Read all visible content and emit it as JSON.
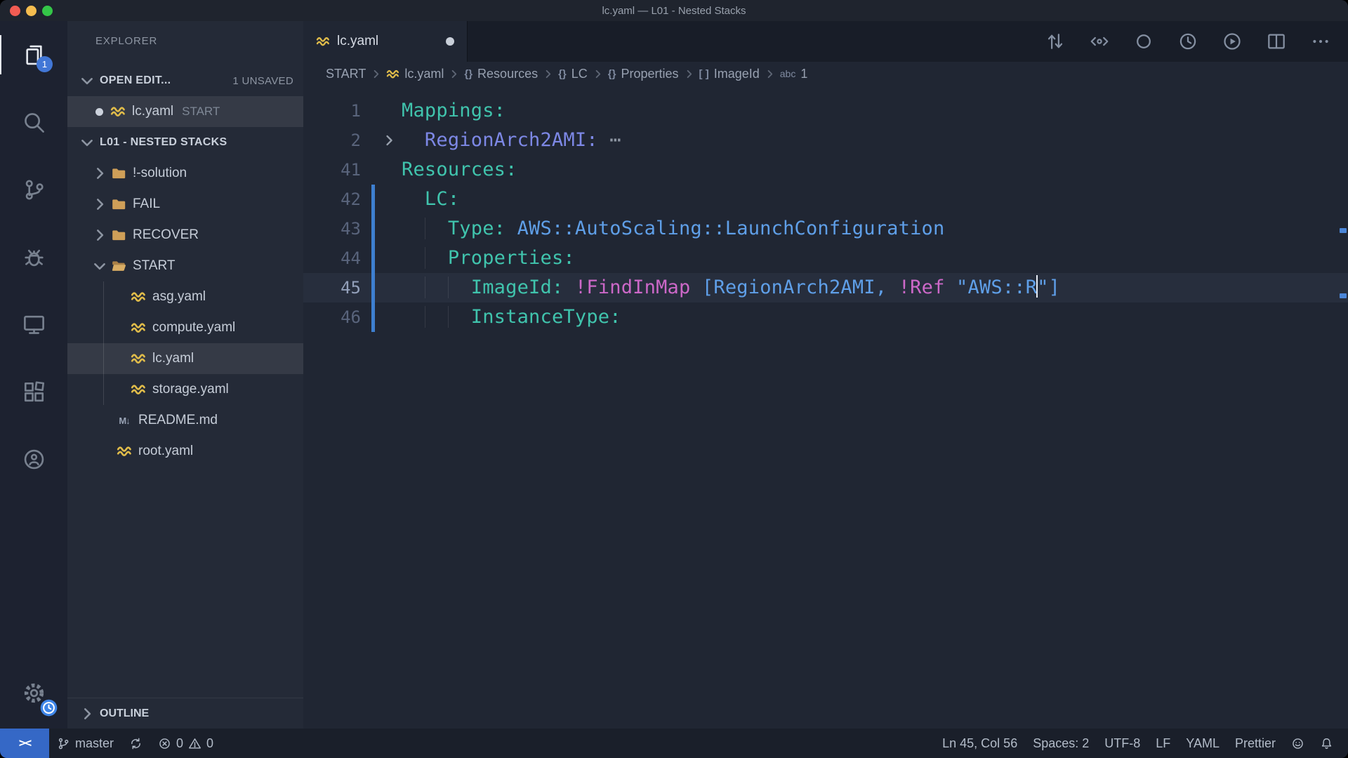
{
  "window": {
    "title": "lc.yaml — L01 - Nested Stacks"
  },
  "activity_bar": {
    "items": [
      {
        "name": "explorer",
        "icon": "files",
        "active": true,
        "badge": "1"
      },
      {
        "name": "search",
        "icon": "search"
      },
      {
        "name": "source-control",
        "icon": "source-control"
      },
      {
        "name": "run-and-debug",
        "icon": "debug"
      },
      {
        "name": "remote-explorer",
        "icon": "remote-explorer"
      },
      {
        "name": "extensions",
        "icon": "extensions"
      },
      {
        "name": "live-share",
        "icon": "live-share"
      }
    ],
    "bottom_items": [
      {
        "name": "manage",
        "icon": "gear",
        "badge_icon": "clock"
      }
    ]
  },
  "sidebar": {
    "title": "EXPLORER",
    "rows": [
      {
        "kind": "section",
        "name": "open-editors-header",
        "label": "OPEN EDIT...",
        "chevron": "down",
        "badge": "1 UNSAVED"
      },
      {
        "kind": "open-editor",
        "icon": "yaml",
        "label": "lc.yaml",
        "decoration": "START",
        "modified": true,
        "selected": true
      },
      {
        "kind": "section",
        "name": "project-section-header",
        "label": "L01 - NESTED STACKS",
        "chevron": "down"
      },
      {
        "kind": "folder",
        "label": "!-solution",
        "chevron": "right"
      },
      {
        "kind": "folder",
        "label": "FAIL",
        "chevron": "right"
      },
      {
        "kind": "folder",
        "label": "RECOVER",
        "chevron": "right"
      },
      {
        "kind": "folder",
        "label": "START",
        "chevron": "down",
        "open": true
      },
      {
        "kind": "file",
        "icon": "yaml",
        "label": "asg.yaml",
        "depth": 2
      },
      {
        "kind": "file",
        "icon": "yaml",
        "label": "compute.yaml",
        "depth": 2
      },
      {
        "kind": "file",
        "icon": "yaml",
        "label": "lc.yaml",
        "depth": 2,
        "selected": true
      },
      {
        "kind": "file",
        "icon": "yaml",
        "label": "storage.yaml",
        "depth": 2
      },
      {
        "kind": "file",
        "icon": "md",
        "label": "README.md",
        "depth": 1
      },
      {
        "kind": "file",
        "icon": "yaml",
        "label": "root.yaml",
        "depth": 1
      }
    ],
    "outline_label": "OUTLINE"
  },
  "editor": {
    "tab": {
      "label": "lc.yaml",
      "icon": "yaml",
      "modified": true
    },
    "actions": [
      "compare-changes",
      "code-lens",
      "circle",
      "file-history",
      "run-code",
      "split-editor",
      "more-actions"
    ],
    "breadcrumbs": [
      {
        "label": "START"
      },
      {
        "icon": "yaml",
        "label": "lc.yaml"
      },
      {
        "icon": "object",
        "label": "Resources"
      },
      {
        "icon": "object",
        "label": "LC"
      },
      {
        "icon": "object",
        "label": "Properties"
      },
      {
        "icon": "array",
        "label": "ImageId"
      },
      {
        "icon": "string",
        "label": "1"
      }
    ],
    "lines": [
      {
        "n": "1",
        "tokens": [
          [
            "key",
            "Mappings:"
          ]
        ]
      },
      {
        "n": "2",
        "fold": true,
        "tokens": [
          [
            "ind",
            "  "
          ],
          [
            "key2",
            "RegionArch2AMI:"
          ],
          [
            "plain",
            " "
          ],
          [
            "fold",
            "⋯"
          ]
        ]
      },
      {
        "n": "41",
        "tokens": [
          [
            "key",
            "Resources:"
          ]
        ]
      },
      {
        "n": "42",
        "mod": true,
        "tokens": [
          [
            "ind",
            "  "
          ],
          [
            "key",
            "LC:"
          ]
        ]
      },
      {
        "n": "43",
        "mod": true,
        "tokens": [
          [
            "ind",
            "  "
          ],
          [
            "ind",
            "  "
          ],
          [
            "key",
            "Type:"
          ],
          [
            "plain",
            " "
          ],
          [
            "val",
            "AWS::AutoScaling::LaunchConfiguration"
          ]
        ]
      },
      {
        "n": "44",
        "mod": true,
        "tokens": [
          [
            "ind",
            "  "
          ],
          [
            "ind",
            "  "
          ],
          [
            "key",
            "Properties:"
          ]
        ]
      },
      {
        "n": "45",
        "mod": true,
        "cur": true,
        "tokens": [
          [
            "ind",
            "  "
          ],
          [
            "ind",
            "  "
          ],
          [
            "ind",
            "  "
          ],
          [
            "key",
            "ImageId:"
          ],
          [
            "plain",
            " "
          ],
          [
            "tag",
            "!FindInMap"
          ],
          [
            "plain",
            " "
          ],
          [
            "punct",
            "["
          ],
          [
            "val",
            "RegionArch2AMI,"
          ],
          [
            "plain",
            " "
          ],
          [
            "tag",
            "!Ref"
          ],
          [
            "plain",
            " "
          ],
          [
            "str",
            "\"AWS::R"
          ],
          [
            "cursor",
            ""
          ],
          [
            "str",
            "\""
          ],
          [
            "punct",
            "]"
          ]
        ]
      },
      {
        "n": "46",
        "mod": true,
        "tokens": [
          [
            "ind",
            "  "
          ],
          [
            "ind",
            "  "
          ],
          [
            "ind",
            "  "
          ],
          [
            "key",
            "InstanceType:"
          ]
        ]
      }
    ]
  },
  "status_bar": {
    "remote_glyph": "><",
    "branch": "master",
    "errors": "0",
    "warnings": "0",
    "cursor_position": "Ln 45, Col 56",
    "indentation": "Spaces: 2",
    "encoding": "UTF-8",
    "eol": "LF",
    "language": "YAML",
    "formatter": "Prettier"
  },
  "colors": {
    "modified_line_blue": "#3e7fd0",
    "badge_blue": "#4277d6",
    "remote_blue": "#3568c6",
    "key_teal": "#40c4ad",
    "nested_key_violet": "#7d88e6",
    "value_blue": "#5f9fe8",
    "tag_magenta": "#cc68c8",
    "yaml_icon_yellow": "#e0bc4a",
    "folder_tan": "#cf9f58",
    "traffic_red": "#f25c53",
    "traffic_yellow": "#f5bd4f",
    "traffic_green": "#34c648"
  }
}
